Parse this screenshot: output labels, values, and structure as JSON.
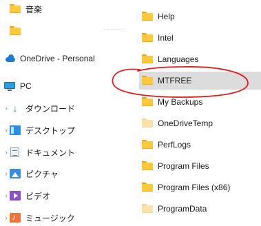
{
  "nav": {
    "items": [
      {
        "label": "音楽",
        "icon": "folder-icon"
      },
      {
        "label": "",
        "icon": "folder-icon"
      },
      {
        "label": "OneDrive - Personal",
        "icon": "onedrive-cloud-icon"
      },
      {
        "label": "PC",
        "icon": "pc-icon"
      },
      {
        "label": "ダウンロード",
        "icon": "download-icon"
      },
      {
        "label": "デスクトップ",
        "icon": "desktop-icon"
      },
      {
        "label": "ドキュメント",
        "icon": "document-icon"
      },
      {
        "label": "ピクチャ",
        "icon": "pictures-icon"
      },
      {
        "label": "ビデオ",
        "icon": "video-icon"
      },
      {
        "label": "ミュージック",
        "icon": "music-icon"
      }
    ]
  },
  "files": [
    {
      "name": "Help",
      "icon": "folder-icon",
      "selected": false,
      "pale": false
    },
    {
      "name": "Intel",
      "icon": "folder-icon",
      "selected": false,
      "pale": false
    },
    {
      "name": "Languages",
      "icon": "folder-icon",
      "selected": false,
      "pale": false
    },
    {
      "name": "MTFREE",
      "icon": "folder-icon",
      "selected": true,
      "pale": false
    },
    {
      "name": "My Backups",
      "icon": "folder-icon",
      "selected": false,
      "pale": false
    },
    {
      "name": "OneDriveTemp",
      "icon": "folder-icon",
      "selected": false,
      "pale": true
    },
    {
      "name": "PerfLogs",
      "icon": "folder-icon",
      "selected": false,
      "pale": false
    },
    {
      "name": "Program Files",
      "icon": "folder-icon",
      "selected": false,
      "pale": false
    },
    {
      "name": "Program Files (x86)",
      "icon": "folder-icon",
      "selected": false,
      "pale": false
    },
    {
      "name": "ProgramData",
      "icon": "folder-icon",
      "selected": false,
      "pale": true
    }
  ],
  "colors": {
    "folder": "#ffc83d",
    "folder_pale": "#fbe3a8",
    "selection": "#dcdcdc",
    "annotation": "#e01b1b",
    "onedrive": "#1f7ad6"
  }
}
